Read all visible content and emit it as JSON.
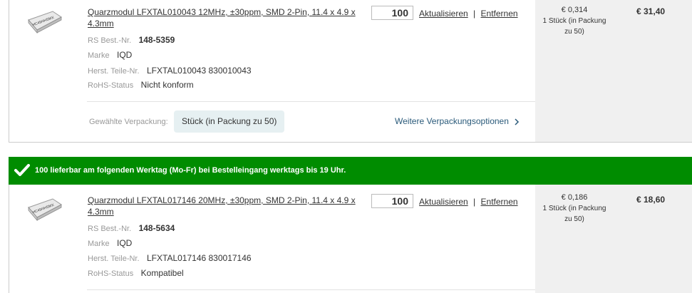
{
  "items": [
    {
      "title": "Quarzmodul LFXTAL010043 12MHz, ±30ppm, SMD 2-Pin, 11.4 x 4.9 x 4.3mm",
      "rs_label": "RS Best.-Nr.",
      "rs_value": "148-5359",
      "brand_label": "Marke",
      "brand_value": "IQD",
      "mfr_label": "Herst. Teile-Nr.",
      "mfr_value": "LFXTAL010043 830010043",
      "rohs_label": "RoHS-Status",
      "rohs_value": "Nicht konform",
      "qty": "100",
      "update_label": "Aktualisieren",
      "separator": "|",
      "remove_label": "Entfernen",
      "unit_price": "€ 0,314",
      "unit_note": "1 Stück (in Packung zu 50)",
      "total": "€ 31,40",
      "pack_label": "Gewählte Verpackung:",
      "pack_value": "Stück (in Packung zu 50)",
      "more_pack": "Weitere Verpackungsoptionen",
      "more_icon": "chevron-right-icon",
      "thumb_text": "HC49/4HSMX"
    },
    {
      "title": "Quarzmodul LFXTAL017146 20MHz, ±30ppm, SMD 2-Pin, 11.4 x 4.9 x 4.3mm",
      "rs_label": "RS Best.-Nr.",
      "rs_value": "148-5634",
      "brand_label": "Marke",
      "brand_value": "IQD",
      "mfr_label": "Herst. Teile-Nr.",
      "mfr_value": "LFXTAL017146 830017146",
      "rohs_label": "RoHS-Status",
      "rohs_value": "Kompatibel",
      "qty": "100",
      "update_label": "Aktualisieren",
      "separator": "|",
      "remove_label": "Entfernen",
      "unit_price": "€ 0,186",
      "unit_note": "1 Stück (in Packung zu 50)",
      "total": "€ 18,60",
      "thumb_text": "HC49/4HSMX"
    }
  ],
  "banner": {
    "text": "100 lieferbar am folgenden Werktag (Mo-Fr) bei Bestelleingang werktags bis 19 Uhr.",
    "icon": "checkmark-icon",
    "color": "#008c00"
  }
}
